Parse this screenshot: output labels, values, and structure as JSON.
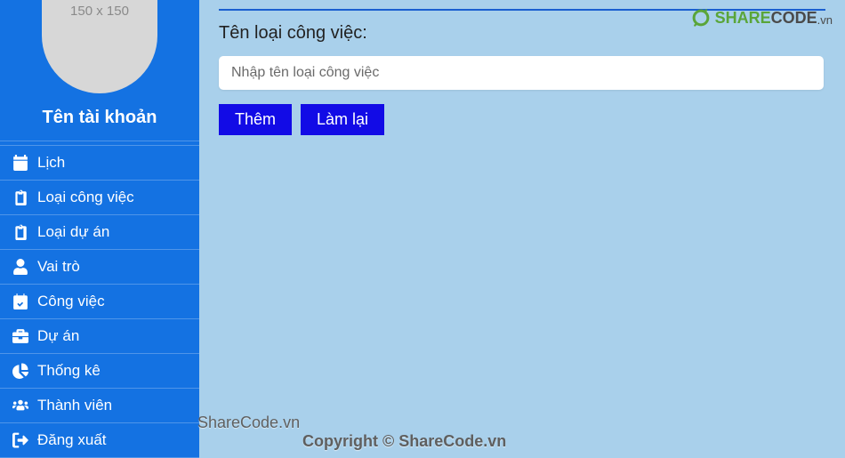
{
  "sidebar": {
    "avatar_placeholder": "150 x 150",
    "account_name": "Tên tài khoản",
    "menu": [
      {
        "label": "Lịch",
        "icon": "calendar-icon"
      },
      {
        "label": "Loại công việc",
        "icon": "clipboard-icon"
      },
      {
        "label": "Loại dự án",
        "icon": "clipboard-icon"
      },
      {
        "label": "Vai trò",
        "icon": "user-icon"
      },
      {
        "label": "Công việc",
        "icon": "calendar-check-icon"
      },
      {
        "label": "Dự án",
        "icon": "briefcase-icon"
      },
      {
        "label": "Thống kê",
        "icon": "chart-pie-icon"
      },
      {
        "label": "Thành viên",
        "icon": "users-icon"
      },
      {
        "label": "Đăng xuất",
        "icon": "logout-icon"
      }
    ]
  },
  "main": {
    "form_label": "Tên loại công việc:",
    "input_placeholder": "Nhập tên loại công việc",
    "add_label": "Thêm",
    "reset_label": "Làm lại"
  },
  "watermark": {
    "logo_share": "SHARE",
    "logo_code": "CODE",
    "logo_vn": ".vn",
    "line1": "ShareCode.vn",
    "line2": "Copyright © ShareCode.vn"
  },
  "colors": {
    "sidebar_bg": "#1472e2",
    "main_bg": "#a9d0eb",
    "button_bg": "#120be6"
  }
}
